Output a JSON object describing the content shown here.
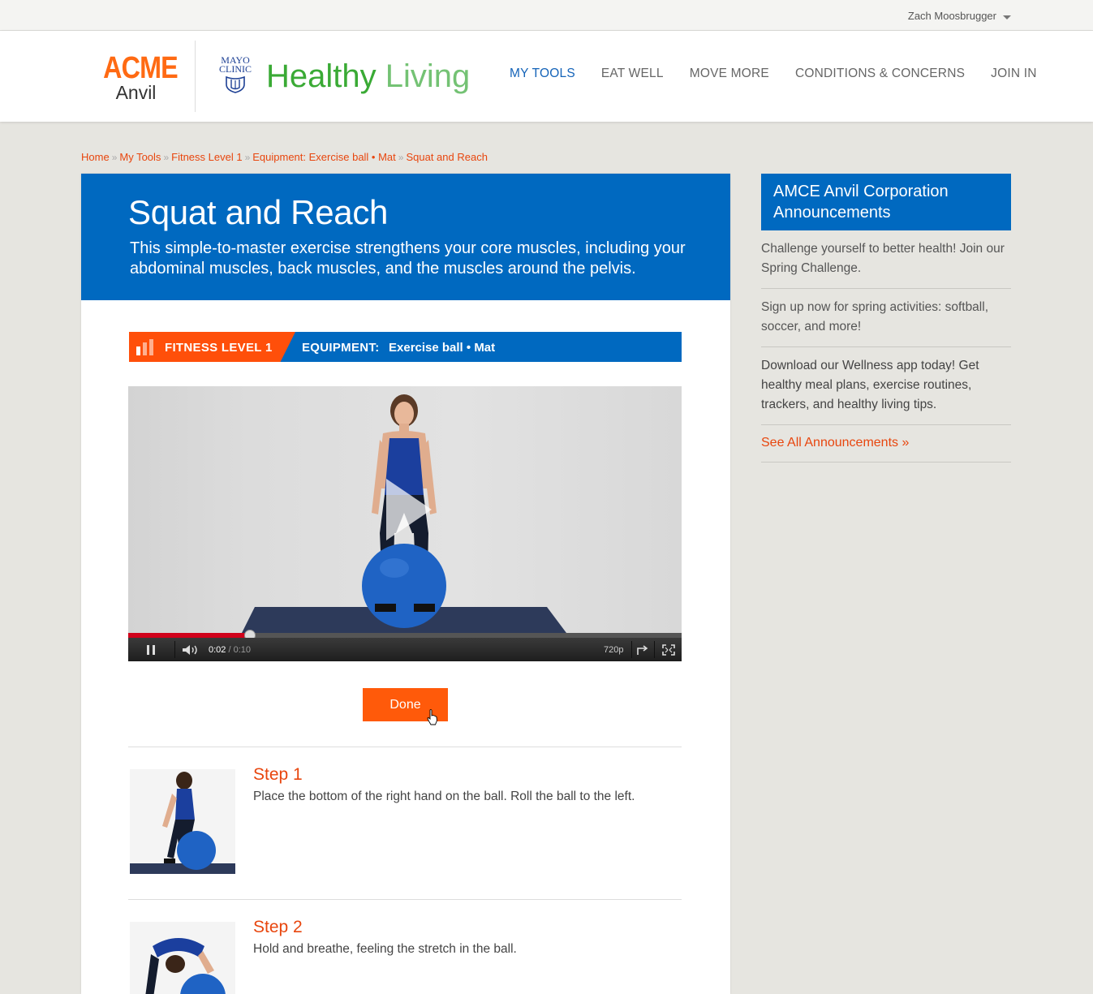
{
  "user": {
    "name": "Zach Moosbrugger"
  },
  "brand": {
    "acme_top": "ACME",
    "acme_bottom": "Anvil",
    "mayo_line1": "MAYO",
    "mayo_line2": "CLINIC",
    "healthy": "Healthy",
    "living": "Living"
  },
  "nav": {
    "items": [
      "MY TOOLS",
      "EAT WELL",
      "MOVE MORE",
      "CONDITIONS & CONCERNS",
      "JOIN IN"
    ],
    "active": "MY TOOLS"
  },
  "breadcrumb": [
    "Home",
    "My Tools",
    "Fitness Level 1",
    "Equipment: Exercise ball • Mat",
    "Squat and Reach"
  ],
  "hero": {
    "title": "Squat and Reach",
    "description": "This simple-to-master exercise strengthens your core muscles, including your abdominal muscles, back muscles, and the muscles around the pelvis."
  },
  "level_bar": {
    "level": "FITNESS LEVEL 1",
    "equipment_label": "EQUIPMENT:",
    "equipment_value": "Exercise ball • Mat"
  },
  "video": {
    "current_time": "0:02",
    "total_time": "/ 0:10",
    "quality": "720p",
    "progress": 0.22
  },
  "done_label": "Done",
  "steps": [
    {
      "title": "Step 1",
      "text": "Place the bottom of the right hand on the ball. Roll the ball to the left."
    },
    {
      "title": "Step 2",
      "text": "Hold and breathe, feeling the stretch in the ball."
    }
  ],
  "sidebar": {
    "title": "AMCE Anvil Corporation Announcements",
    "items": [
      "Challenge yourself to better health! Join our Spring Challenge.",
      "Sign up now for spring activities: softball, soccer, and more!",
      "Download our Wellness app today! Get healthy meal plans, exercise routines, trackers, and healthy living tips."
    ],
    "see_all": "See All Announcements",
    "see_all_arrow": "»"
  },
  "colors": {
    "brand_blue": "#0069c0",
    "accent_orange": "#ff5a0a",
    "link_red": "#e8460e",
    "green": "#3aaa35"
  }
}
